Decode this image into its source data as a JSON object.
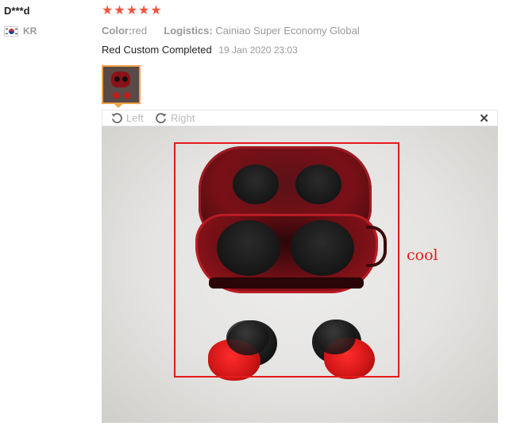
{
  "user": {
    "name": "D***d",
    "country_code": "KR",
    "flag_icon": "south-korea-flag-icon"
  },
  "rating": {
    "stars": 5,
    "max": 5,
    "color": "#f0543c"
  },
  "meta": {
    "color_label": "Color:",
    "color_value": "red",
    "logistics_label": "Logistics:",
    "logistics_value": "Cainiao Super Economy Global"
  },
  "review": {
    "text": "Red Custom Completed",
    "date": "19 Jan 2020 23:03"
  },
  "viewer": {
    "rotate_left_label": "Left",
    "rotate_right_label": "Right",
    "close_glyph": "✕",
    "accent": "#f0a34a"
  },
  "photo": {
    "annotation_label": "cool",
    "annotation_color": "#e61a1a"
  }
}
